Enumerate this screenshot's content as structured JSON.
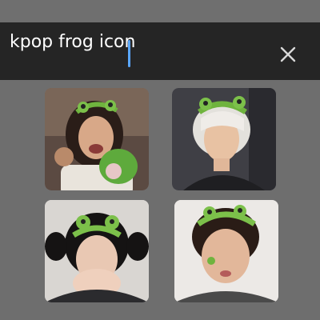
{
  "search": {
    "query": "kpop frog icon",
    "clear_icon": "close-icon"
  },
  "results": [
    {
      "name": "image-result-1",
      "description_icon": "frog-headband-photo"
    },
    {
      "name": "image-result-2",
      "description_icon": "frog-headband-photo"
    },
    {
      "name": "image-result-3",
      "description_icon": "frog-headband-photo"
    },
    {
      "name": "image-result-4",
      "description_icon": "frog-headband-photo"
    }
  ],
  "colors": {
    "background": "#6e6e6e",
    "search_bar": "#252525",
    "caret": "#5aa7ff",
    "frog_green": "#7cc04a"
  }
}
